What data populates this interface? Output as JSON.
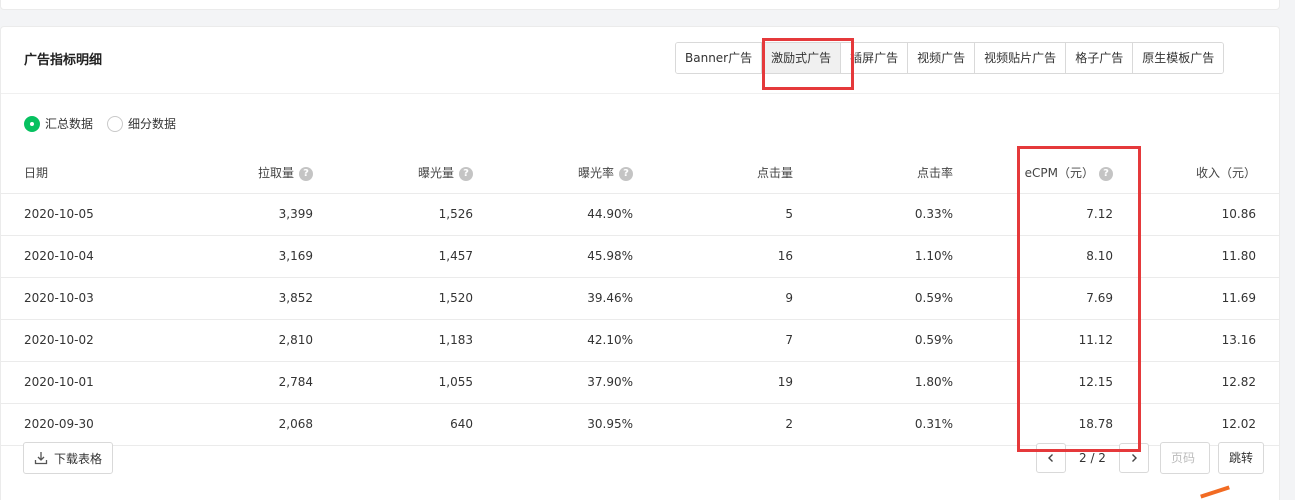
{
  "card": {
    "title": "广告指标明细"
  },
  "tabs": [
    {
      "label": "Banner广告"
    },
    {
      "label": "激励式广告"
    },
    {
      "label": "插屏广告"
    },
    {
      "label": "视频广告"
    },
    {
      "label": "视频贴片广告"
    },
    {
      "label": "格子广告"
    },
    {
      "label": "原生模板广告"
    }
  ],
  "active_tab_index": 1,
  "radio": {
    "summary_label": "汇总数据",
    "detail_label": "细分数据",
    "selected": "summary"
  },
  "table": {
    "headers": [
      "日期",
      "拉取量",
      "曝光量",
      "曝光率",
      "点击量",
      "点击率",
      "eCPM（元）",
      "收入（元）"
    ],
    "help_icon": "?",
    "rows": [
      [
        "2020-10-05",
        "3,399",
        "1,526",
        "44.90%",
        "5",
        "0.33%",
        "7.12",
        "10.86"
      ],
      [
        "2020-10-04",
        "3,169",
        "1,457",
        "45.98%",
        "16",
        "1.10%",
        "8.10",
        "11.80"
      ],
      [
        "2020-10-03",
        "3,852",
        "1,520",
        "39.46%",
        "9",
        "0.59%",
        "7.69",
        "11.69"
      ],
      [
        "2020-10-02",
        "2,810",
        "1,183",
        "42.10%",
        "7",
        "0.59%",
        "11.12",
        "13.16"
      ],
      [
        "2020-10-01",
        "2,784",
        "1,055",
        "37.90%",
        "19",
        "1.80%",
        "12.15",
        "12.82"
      ],
      [
        "2020-09-30",
        "2,068",
        "640",
        "30.95%",
        "2",
        "0.31%",
        "18.78",
        "12.02"
      ]
    ]
  },
  "footer": {
    "download_label": "下载表格",
    "page_indicator": "2 / 2",
    "page_input_placeholder": "页码",
    "jump_label": "跳转"
  },
  "colors": {
    "accent_green": "#07c160",
    "highlight_red": "#e5393b"
  }
}
